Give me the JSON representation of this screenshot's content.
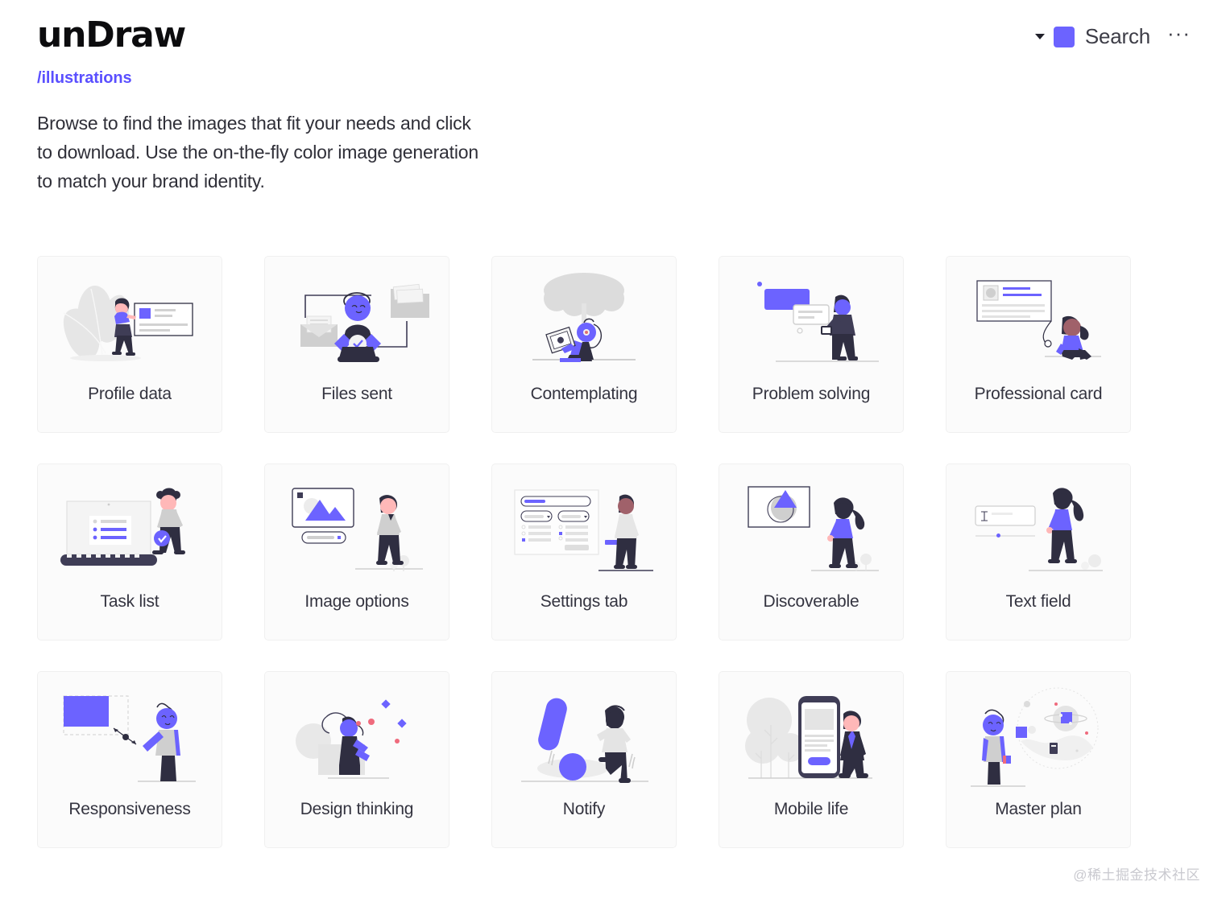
{
  "header": {
    "brand": "unDraw",
    "caret_icon": "chevron-down-icon",
    "swatch_icon": "color-swatch-icon",
    "swatch_color": "#6c63ff",
    "search_label": "Search",
    "more_label": "···"
  },
  "intro": {
    "route": "/illustrations",
    "description": "Browse to find the images that fit your needs and click to download. Use the on-the-fly color image generation to match your brand identity."
  },
  "palette": {
    "accent": "#6c63ff",
    "accent_route": "#5a4fff",
    "dark": "#2f2e41",
    "gray": "#cccccc",
    "light_gray": "#e6e6e6",
    "card_bg": "#fbfbfb",
    "card_border": "#f0f0f0",
    "skin": "#ffb8b8",
    "skin_dark": "#a0616a"
  },
  "gallery": {
    "items": [
      {
        "label": "Profile data",
        "art": "profile-data"
      },
      {
        "label": "Files sent",
        "art": "files-sent"
      },
      {
        "label": "Contemplating",
        "art": "contemplating"
      },
      {
        "label": "Problem solving",
        "art": "problem-solving"
      },
      {
        "label": "Professional card",
        "art": "professional-card"
      },
      {
        "label": "Task list",
        "art": "task-list"
      },
      {
        "label": "Image options",
        "art": "image-options"
      },
      {
        "label": "Settings tab",
        "art": "settings-tab"
      },
      {
        "label": "Discoverable",
        "art": "discoverable"
      },
      {
        "label": "Text field",
        "art": "text-field"
      },
      {
        "label": "Responsiveness",
        "art": "responsiveness"
      },
      {
        "label": "Design thinking",
        "art": "design-thinking"
      },
      {
        "label": "Notify",
        "art": "notify"
      },
      {
        "label": "Mobile life",
        "art": "mobile-life"
      },
      {
        "label": "Master plan",
        "art": "master-plan"
      }
    ]
  },
  "watermark": "@稀土掘金技术社区"
}
